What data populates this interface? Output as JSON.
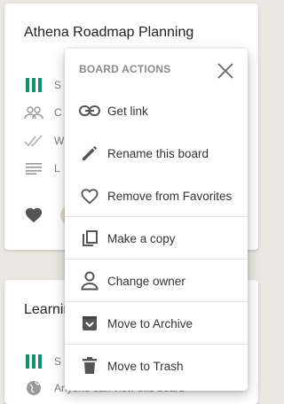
{
  "boards": [
    {
      "title": "Athena Roadmap Planning",
      "rows": [
        {
          "icon": "board-columns-icon",
          "text": "S"
        },
        {
          "icon": "team-icon",
          "text": "C"
        },
        {
          "icon": "checkmarks-icon",
          "text": "W"
        },
        {
          "icon": "lines-icon",
          "text": "L"
        }
      ],
      "favorite": true
    },
    {
      "title": "Learnin",
      "rows": [
        {
          "icon": "board-columns-icon",
          "text": "S"
        },
        {
          "icon": "globe-icon",
          "text": "Anyone can view this board"
        }
      ]
    }
  ],
  "menu": {
    "header": "BOARD ACTIONS",
    "close_icon": "close-icon",
    "items": [
      {
        "label": "Get link",
        "icon": "link-icon"
      },
      {
        "label": "Rename this board",
        "icon": "pencil-icon"
      },
      {
        "label": "Remove from Favorites",
        "icon": "heart-outline-icon"
      },
      {
        "label": "Make a copy",
        "icon": "copy-icon"
      },
      {
        "label": "Change owner",
        "icon": "person-icon"
      },
      {
        "label": "Move to Archive",
        "icon": "archive-icon"
      },
      {
        "label": "Move to Trash",
        "icon": "trash-icon"
      }
    ]
  },
  "colors": {
    "accent_teal": "#1e8a6e",
    "icon_gray": "#666666",
    "muted_gray": "#9a9a9a"
  }
}
